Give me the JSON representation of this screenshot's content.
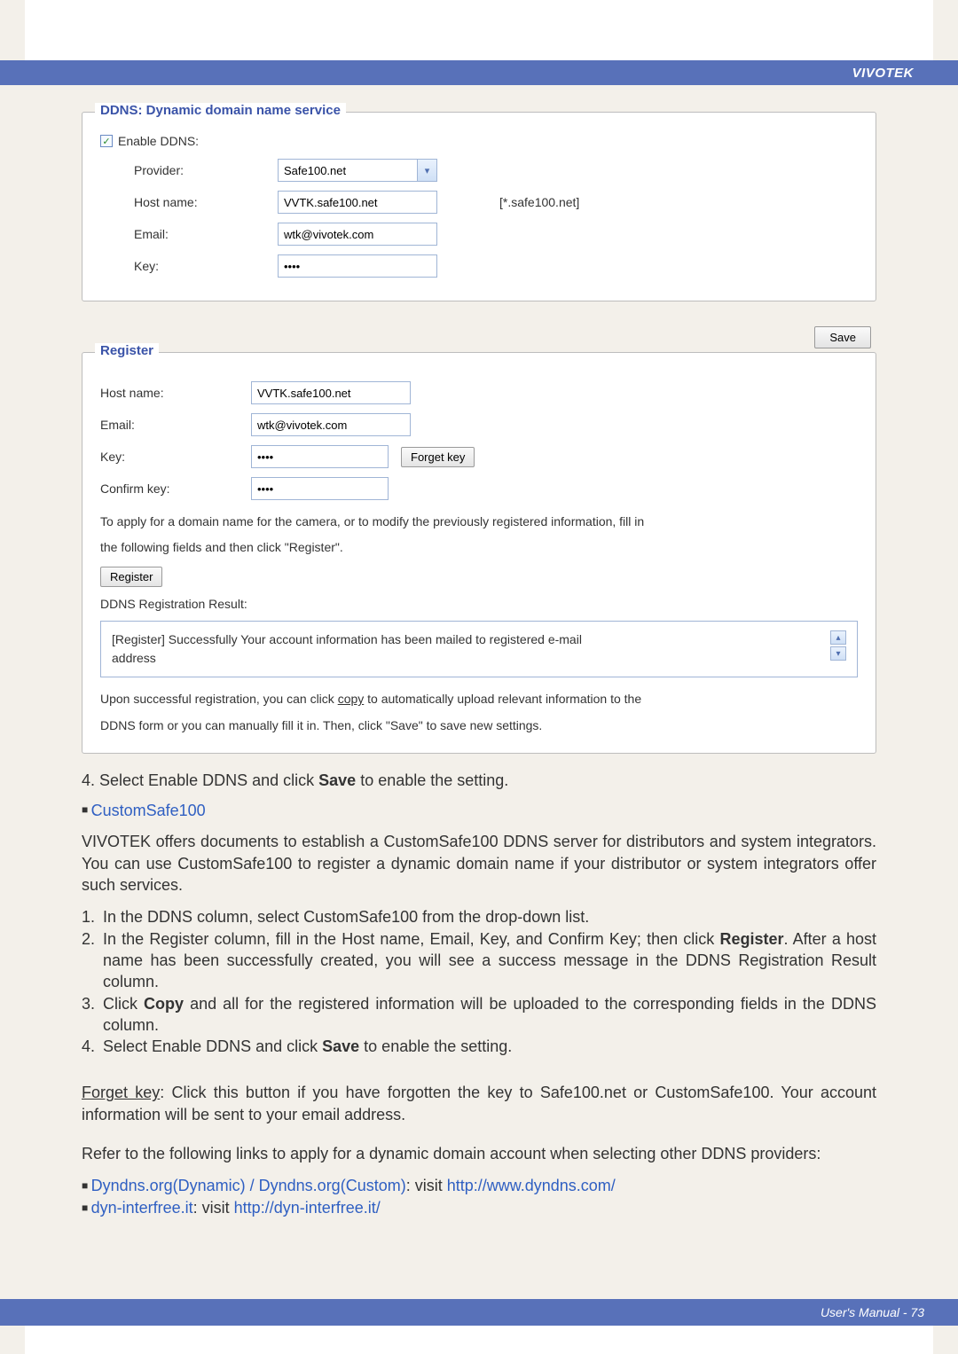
{
  "brand": "VIVOTEK",
  "panel1": {
    "title": "DDNS: Dynamic domain name service",
    "enable_label": "Enable DDNS:",
    "provider_label": "Provider:",
    "provider_value": "Safe100.net",
    "hostname_label": "Host name:",
    "hostname_value": "VVTK.safe100.net",
    "hostname_suffix": "[*.safe100.net]",
    "email_label": "Email:",
    "email_value": "wtk@vivotek.com",
    "key_label": "Key:",
    "key_value": "••••",
    "save": "Save"
  },
  "panel2": {
    "title": "Register",
    "hostname_label": "Host name:",
    "hostname_value": "VVTK.safe100.net",
    "email_label": "Email:",
    "email_value": "wtk@vivotek.com",
    "key_label": "Key:",
    "key_value": "••••",
    "forget_btn": "Forget key",
    "confirm_label": "Confirm key:",
    "confirm_value": "••••",
    "note1": "To apply for a domain name for the camera, or to modify the previously registered information, fill in",
    "note2": "the following fields and then click \"Register\".",
    "register_btn": "Register",
    "result_label": "DDNS Registration Result:",
    "result_text": "[Register] Successfully  Your account information has been mailed to registered e-mail address",
    "upon1a": "Upon successful registration, you can click ",
    "upon_copy": "copy",
    "upon1b": " to automatically upload relevant information to the",
    "upon2": "DDNS form or you can manually fill it in. Then, click \"Save\" to save new settings."
  },
  "body": {
    "step4_top": "4. Select Enable DDNS and click Save to enable the setting.",
    "step4_a": "4. Select Enable DDNS and click ",
    "step4_save": "Save",
    "step4_b": " to enable the setting.",
    "custom_head": "CustomSafe100",
    "custom_para": "VIVOTEK offers documents to establish a CustomSafe100 DDNS server for distributors and system integrators. You can use CustomSafe100 to register a dynamic domain name if your distributor or system integrators offer such services.",
    "li1": "In the DDNS column, select CustomSafe100 from the drop-down list.",
    "li2a": "In the Register column, fill in the Host name, Email, Key, and Confirm Key; then click ",
    "li2_reg": "Register",
    "li2b": ". After a host name has been successfully created, you will see a success message in the DDNS Registration Result column.",
    "li3a": "Click ",
    "li3_copy": "Copy",
    "li3b": " and all for the registered information will be uploaded to the corresponding fields in the DDNS column.",
    "li4a": "Select Enable DDNS and click ",
    "li4_save": "Save",
    "li4b": " to enable the setting.",
    "forget_head": "Forget key",
    "forget_para": ": Click this button if you have forgotten the key to Safe100.net or CustomSafe100. Your account information will be sent to your email address.",
    "refer_para": "Refer to the following links to apply for a dynamic domain account when selecting other DDNS providers:",
    "prov1_name": "Dyndns.org(Dynamic) / Dyndns.org(Custom)",
    "prov1_visit": ": visit ",
    "prov1_url": "http://www.dyndns.com/",
    "prov2_name": "dyn-interfree.it",
    "prov2_visit": ": visit ",
    "prov2_url": "http://dyn-interfree.it/"
  },
  "footer": "User's Manual - 73"
}
